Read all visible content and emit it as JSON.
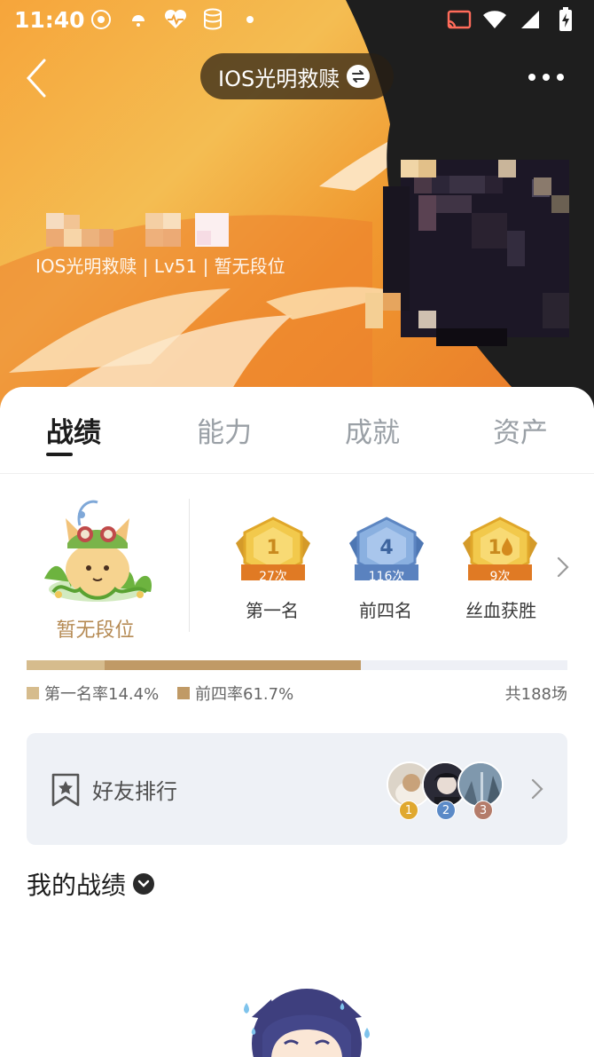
{
  "status_bar": {
    "time": "11:40",
    "left_icons": [
      "app-notification-icon",
      "weather-icon",
      "health-icon",
      "storage-icon",
      "dot-icon"
    ],
    "right_icons": [
      "cast-icon",
      "wifi-icon",
      "cellular-signal-icon",
      "battery-charging-icon"
    ]
  },
  "header": {
    "server_name": "IOS光明救赎",
    "back_icon": "chevron-left-icon",
    "swap_icon": "swap-icon",
    "more_icon": "more-dots-icon"
  },
  "profile": {
    "info_line": "IOS光明救赎 | Lv51 | 暂无段位"
  },
  "tabs": [
    {
      "label": "战绩",
      "active": true
    },
    {
      "label": "能力",
      "active": false
    },
    {
      "label": "成就",
      "active": false
    },
    {
      "label": "资产",
      "active": false
    }
  ],
  "rank": {
    "label": "暂无段位"
  },
  "medals": [
    {
      "emblem": "1",
      "count": "27次",
      "label": "第一名",
      "color": "#e8b23a"
    },
    {
      "emblem": "4",
      "count": "116次",
      "label": "前四名",
      "color": "#6f93c9"
    },
    {
      "emblem": "1",
      "count": "9次",
      "label": "丝血获胜",
      "color": "#e8b23a"
    }
  ],
  "progress": {
    "first_rate": 0.144,
    "top4_rate": 0.617,
    "first_color": "#d6bc8d",
    "top4_color": "#c09a66",
    "legend_first": "第一名率14.4%",
    "legend_top4": "前四率61.7%",
    "total": "共188场"
  },
  "friends": {
    "title": "好友排行",
    "ranks": [
      "1",
      "2",
      "3"
    ],
    "badge_colors": [
      "#e0a82e",
      "#5b8ac7",
      "#b47c6a"
    ]
  },
  "my_record": {
    "title": "我的战绩"
  }
}
